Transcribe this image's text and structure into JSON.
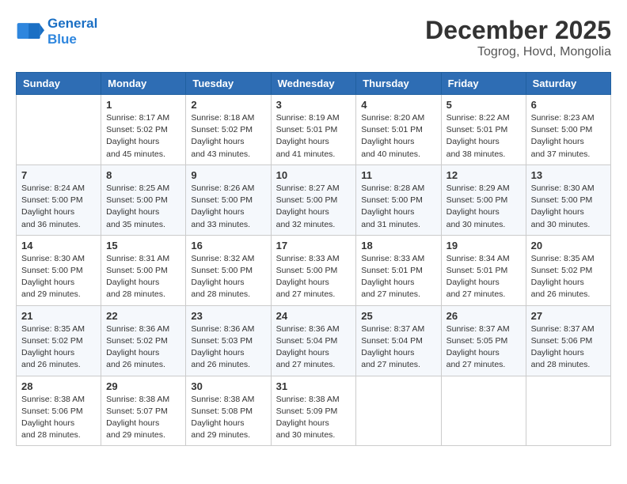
{
  "header": {
    "logo_line1": "General",
    "logo_line2": "Blue",
    "month": "December 2025",
    "location": "Togrog, Hovd, Mongolia"
  },
  "weekdays": [
    "Sunday",
    "Monday",
    "Tuesday",
    "Wednesday",
    "Thursday",
    "Friday",
    "Saturday"
  ],
  "weeks": [
    [
      {
        "day": "",
        "sunrise": "",
        "sunset": "",
        "daylight": ""
      },
      {
        "day": "1",
        "sunrise": "8:17 AM",
        "sunset": "5:02 PM",
        "daylight": "8 hours and 45 minutes."
      },
      {
        "day": "2",
        "sunrise": "8:18 AM",
        "sunset": "5:02 PM",
        "daylight": "8 hours and 43 minutes."
      },
      {
        "day": "3",
        "sunrise": "8:19 AM",
        "sunset": "5:01 PM",
        "daylight": "8 hours and 41 minutes."
      },
      {
        "day": "4",
        "sunrise": "8:20 AM",
        "sunset": "5:01 PM",
        "daylight": "8 hours and 40 minutes."
      },
      {
        "day": "5",
        "sunrise": "8:22 AM",
        "sunset": "5:01 PM",
        "daylight": "8 hours and 38 minutes."
      },
      {
        "day": "6",
        "sunrise": "8:23 AM",
        "sunset": "5:00 PM",
        "daylight": "8 hours and 37 minutes."
      }
    ],
    [
      {
        "day": "7",
        "sunrise": "8:24 AM",
        "sunset": "5:00 PM",
        "daylight": "8 hours and 36 minutes."
      },
      {
        "day": "8",
        "sunrise": "8:25 AM",
        "sunset": "5:00 PM",
        "daylight": "8 hours and 35 minutes."
      },
      {
        "day": "9",
        "sunrise": "8:26 AM",
        "sunset": "5:00 PM",
        "daylight": "8 hours and 33 minutes."
      },
      {
        "day": "10",
        "sunrise": "8:27 AM",
        "sunset": "5:00 PM",
        "daylight": "8 hours and 32 minutes."
      },
      {
        "day": "11",
        "sunrise": "8:28 AM",
        "sunset": "5:00 PM",
        "daylight": "8 hours and 31 minutes."
      },
      {
        "day": "12",
        "sunrise": "8:29 AM",
        "sunset": "5:00 PM",
        "daylight": "8 hours and 30 minutes."
      },
      {
        "day": "13",
        "sunrise": "8:30 AM",
        "sunset": "5:00 PM",
        "daylight": "8 hours and 30 minutes."
      }
    ],
    [
      {
        "day": "14",
        "sunrise": "8:30 AM",
        "sunset": "5:00 PM",
        "daylight": "8 hours and 29 minutes."
      },
      {
        "day": "15",
        "sunrise": "8:31 AM",
        "sunset": "5:00 PM",
        "daylight": "8 hours and 28 minutes."
      },
      {
        "day": "16",
        "sunrise": "8:32 AM",
        "sunset": "5:00 PM",
        "daylight": "8 hours and 28 minutes."
      },
      {
        "day": "17",
        "sunrise": "8:33 AM",
        "sunset": "5:00 PM",
        "daylight": "8 hours and 27 minutes."
      },
      {
        "day": "18",
        "sunrise": "8:33 AM",
        "sunset": "5:01 PM",
        "daylight": "8 hours and 27 minutes."
      },
      {
        "day": "19",
        "sunrise": "8:34 AM",
        "sunset": "5:01 PM",
        "daylight": "8 hours and 27 minutes."
      },
      {
        "day": "20",
        "sunrise": "8:35 AM",
        "sunset": "5:02 PM",
        "daylight": "8 hours and 26 minutes."
      }
    ],
    [
      {
        "day": "21",
        "sunrise": "8:35 AM",
        "sunset": "5:02 PM",
        "daylight": "8 hours and 26 minutes."
      },
      {
        "day": "22",
        "sunrise": "8:36 AM",
        "sunset": "5:02 PM",
        "daylight": "8 hours and 26 minutes."
      },
      {
        "day": "23",
        "sunrise": "8:36 AM",
        "sunset": "5:03 PM",
        "daylight": "8 hours and 26 minutes."
      },
      {
        "day": "24",
        "sunrise": "8:36 AM",
        "sunset": "5:04 PM",
        "daylight": "8 hours and 27 minutes."
      },
      {
        "day": "25",
        "sunrise": "8:37 AM",
        "sunset": "5:04 PM",
        "daylight": "8 hours and 27 minutes."
      },
      {
        "day": "26",
        "sunrise": "8:37 AM",
        "sunset": "5:05 PM",
        "daylight": "8 hours and 27 minutes."
      },
      {
        "day": "27",
        "sunrise": "8:37 AM",
        "sunset": "5:06 PM",
        "daylight": "8 hours and 28 minutes."
      }
    ],
    [
      {
        "day": "28",
        "sunrise": "8:38 AM",
        "sunset": "5:06 PM",
        "daylight": "8 hours and 28 minutes."
      },
      {
        "day": "29",
        "sunrise": "8:38 AM",
        "sunset": "5:07 PM",
        "daylight": "8 hours and 29 minutes."
      },
      {
        "day": "30",
        "sunrise": "8:38 AM",
        "sunset": "5:08 PM",
        "daylight": "8 hours and 29 minutes."
      },
      {
        "day": "31",
        "sunrise": "8:38 AM",
        "sunset": "5:09 PM",
        "daylight": "8 hours and 30 minutes."
      },
      {
        "day": "",
        "sunrise": "",
        "sunset": "",
        "daylight": ""
      },
      {
        "day": "",
        "sunrise": "",
        "sunset": "",
        "daylight": ""
      },
      {
        "day": "",
        "sunrise": "",
        "sunset": "",
        "daylight": ""
      }
    ]
  ]
}
